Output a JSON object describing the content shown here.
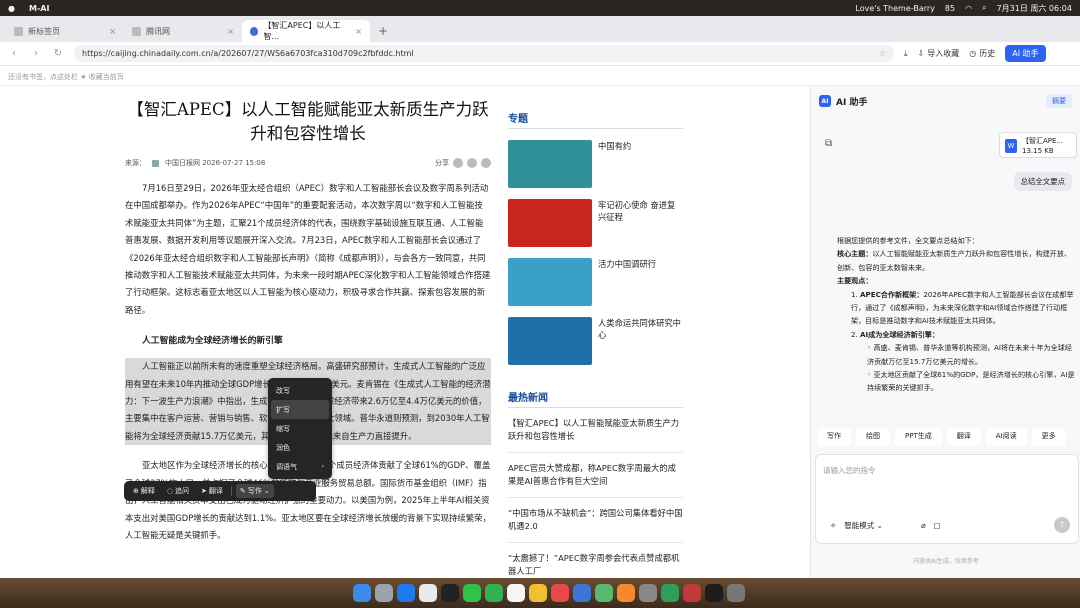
{
  "menubar": {
    "app": "M-AI",
    "music": "Love's Theme-Barry",
    "battery": "85",
    "datetime": "7月31日 周六 06:04"
  },
  "tabs": [
    {
      "label": "新标签页"
    },
    {
      "label": "腾讯网"
    },
    {
      "label": "【智汇APEC】以人工智..."
    }
  ],
  "toolbar": {
    "url": "https://caijing.chinadaily.com.cn/a/202607/27/WS6a6703fca310d709c2fbfddc.html",
    "import_label": "导入收藏",
    "history_label": "历史",
    "ai_label": "AI 助手"
  },
  "bookmarks_hint": "还没有书签，点这处栏 ★ 收藏当前页",
  "article": {
    "title": "【智汇APEC】以人工智能赋能亚太新质生产力跃升和包容性增长",
    "source_label": "来源：",
    "source": "中国日报网 2026-07-27 15:08",
    "share": "分享",
    "para1": "7月16日至29日，2026年亚太经合组织（APEC）数字和人工智能部长会议及数字周系列活动在中国成都举办。作为2026年APEC“中国年”的重要配套活动，本次数字周以“数字和人工智能技术赋能亚太共同体”为主题，汇聚21个成员经济体的代表，围绕数字基础设施互联互通、人工智能普惠发展、数据开发利用等议题展开深入交流。7月23日，APEC数字和人工智能部长会议通过了《2026年亚太经合组织数字和人工智能部长声明》（简称《成都声明》），与会各方一致同意，共同推动数字和人工智能技术赋能亚太共同体，为未来一段时期APEC深化数字和人工智能领域合作搭建了行动框架。这标志着亚太地区以人工智能为核心驱动力，积极寻求合作共赢、探索包容发展的新路径。",
    "heading": "人工智能成为全球经济增长的新引擎",
    "para2_a": "人工智能正以前所未有的速度重塑全球经济格局。高盛研究部预计，生成式人工智能的广泛应用有望在未来10年内推动全球GDP增长7%，约合7万亿美元。麦肯锡在《生成式人工智能的经济潜力：下一波生产力浪潮》中指出，生成式AI每年可为全球经济带来2.6万亿至4.4万亿美元的价值，主要集中在客户运营、营销与销售、软件工程和研发四大领域。普华永道则预测，到2030年人工智能将为全球经济贡献15.7万亿美元，其中约6.6万亿美元来自生产力直接提升。",
    "para2_b": "亚太地区作为全球经济增长的核心引擎，APEC 21个成员经济体贡献了全球61%的GDP、覆盖了全球37%的人口，并占据了全球46%的货物与商业服务贸易总额。国际货币基金组织（IMF）指出，人工智能相关资本支出已成为驱动经济扩张的重要动力。以美国为例，2025年上半年AI相关资本支出对美国GDP增长的贡献达到1.1%。亚太地区要在全球经济增长放缓的背景下实现持续繁荣，人工智能无疑是关键抓手。"
  },
  "sidebar": {
    "topics_title": "专题",
    "topics": [
      {
        "label": "中国有约",
        "color": "#2f8f9a"
      },
      {
        "label": "牢记初心使命 奋进复兴征程",
        "color": "#c8261d"
      },
      {
        "label": "活力中国调研行",
        "color": "#3aa0c8"
      },
      {
        "label": "人类命运共同体研究中心",
        "color": "#1f6fa8"
      }
    ],
    "news_title": "最热新闻",
    "news": [
      "【智汇APEC】以人工智能赋能亚太新质生产力跃升和包容性增长",
      "APEC官员大赞成都，称APEC数字周最大的成果是AI普惠合作有巨大空间",
      "“中国市场从不缺机会”：跨国公司集体看好中国机遇2.0",
      "“太震撼了！”APEC数字周参会代表点赞成都机器人工厂"
    ]
  },
  "context_menu": {
    "items": [
      "改写",
      "扩写",
      "缩写",
      "润色",
      "调语气"
    ]
  },
  "floating_toolbar": {
    "explain": "解释",
    "ask": "追问",
    "translate": "翻译",
    "write": "写作"
  },
  "ai_panel": {
    "title": "AI 助手",
    "summary_btn": "摘要",
    "file_name": "【智汇APE...",
    "file_size": "13.15 KB",
    "user_msg": "总结全文要点",
    "answer_intro": "根据您提供的参考文件，全文要点总结如下：",
    "answer_theme_label": "核心主题：",
    "answer_theme": "以人工智能赋能亚太新质生产力跃升和包容性增长，构建开放、创新、包容的亚太数智未来。",
    "answer_points_label": "主要观点：",
    "point1_label": "APEC合作新框架：",
    "point1": "2026年APEC数字和人工智能部长会议在成都举行，通过了《成都声明》，为未来深化数字和AI领域合作搭建了行动框架，目标是推动数字和AI技术赋能亚太共同体。",
    "point2_label": "AI成为全球经济新引擎：",
    "sub1": "高盛、麦肯锡、普华永道等机构预测，AI将在未来十年为全球经济贡献万亿至15.7万亿美元的增长。",
    "sub2": "亚太地区贡献了全球61%的GDP，是经济增长的核心引擎，AI是持续繁荣的关键抓手。",
    "tools": [
      "写作",
      "绘图",
      "PPT生成",
      "翻译",
      "AI阅读",
      "更多"
    ],
    "input_placeholder": "请输入您的指令",
    "mode_label": "智能模式",
    "footnote": "内容由AI生成，仅供参考"
  }
}
